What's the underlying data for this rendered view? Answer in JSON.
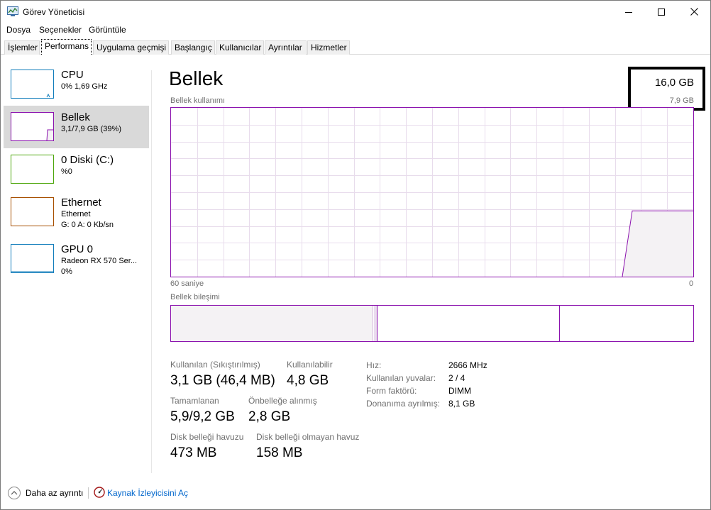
{
  "window": {
    "title": "Görev Yöneticisi"
  },
  "menu": [
    "Dosya",
    "Seçenekler",
    "Görüntüle"
  ],
  "tabs": [
    {
      "label": "İşlemler",
      "active": false
    },
    {
      "label": "Performans",
      "active": true
    },
    {
      "label": "Uygulama geçmişi",
      "active": false
    },
    {
      "label": "Başlangıç",
      "active": false
    },
    {
      "label": "Kullanıcılar",
      "active": false
    },
    {
      "label": "Ayrıntılar",
      "active": false
    },
    {
      "label": "Hizmetler",
      "active": false
    }
  ],
  "sidebar": {
    "items": [
      {
        "title": "CPU",
        "line1": "0% 1,69 GHz",
        "line2": "",
        "color": "#117dbb",
        "selected": false
      },
      {
        "title": "Bellek",
        "line1": "3,1/7,9 GB (39%)",
        "line2": "",
        "color": "#8b12ae",
        "selected": true
      },
      {
        "title": "0 Diski (C:)",
        "line1": "%0",
        "line2": "",
        "color": "#4da60c",
        "selected": false
      },
      {
        "title": "Ethernet",
        "line1": "Ethernet",
        "line2": "G: 0 A: 0 Kb/sn",
        "color": "#a74f01",
        "selected": false
      },
      {
        "title": "GPU 0",
        "line1": "Radeon RX 570 Ser...",
        "line2": "0%",
        "color": "#117dbb",
        "selected": false
      }
    ]
  },
  "main": {
    "title": "Bellek",
    "total": "16,0 GB",
    "usable": "7,9 GB",
    "usage_label": "Bellek kullanımı",
    "time_left": "60 saniye",
    "time_right": "0",
    "composition_label": "Bellek bileşimi",
    "stats": [
      {
        "label": "Kullanılan (Sıkıştırılmış)",
        "value": "3,1 GB (46,4 MB)"
      },
      {
        "label": "Kullanılabilir",
        "value": "4,8 GB"
      },
      {
        "label": "Tamamlanan",
        "value": "5,9/9,2 GB"
      },
      {
        "label": "Önbelleğe alınmış",
        "value": "2,8 GB"
      },
      {
        "label": "Disk belleği havuzu",
        "value": "473 MB"
      },
      {
        "label": "Disk belleği olmayan havuz",
        "value": "158 MB"
      }
    ],
    "details": [
      {
        "key": "Hız:",
        "value": "2666 MHz"
      },
      {
        "key": "Kullanılan yuvalar:",
        "value": "2 / 4"
      },
      {
        "key": "Form faktörü:",
        "value": "DIMM"
      },
      {
        "key": "Donanıma ayrılmış:",
        "value": "8,1 GB"
      }
    ],
    "usage_fraction": 0.39
  },
  "footer": {
    "fewer_details": "Daha az ayrıntı",
    "resource_monitor": "Kaynak İzleyicisini Aç"
  },
  "colors": {
    "memory_accent": "#8b12ae",
    "memory_fill": "#f4f2f4",
    "link": "#0066cc"
  }
}
